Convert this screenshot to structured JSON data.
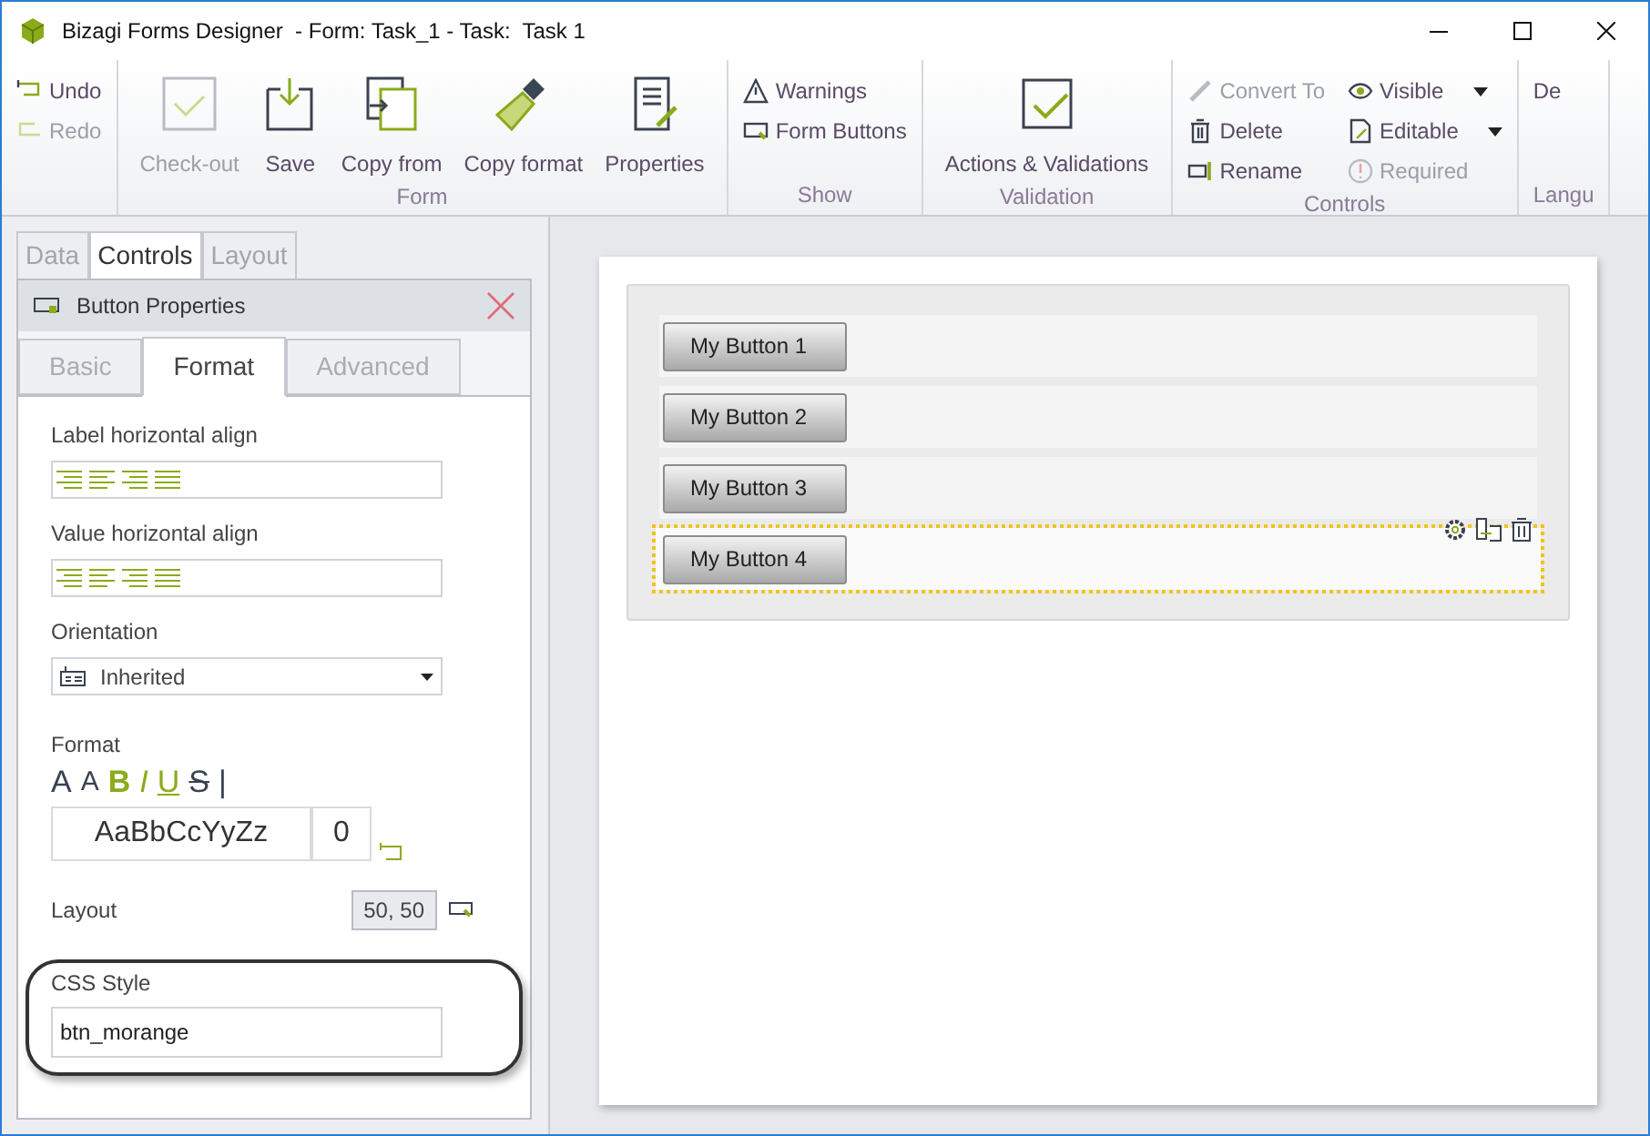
{
  "window": {
    "title": "Bizagi Forms Designer  - Form: Task_1 - Task:  Task 1"
  },
  "ribbon": [
    {
      "columns": [
        {
          "kind": "small",
          "items": [
            {
              "label": "Undo",
              "disabled": false
            },
            {
              "label": "Redo",
              "disabled": true
            }
          ]
        }
      ]
    },
    {
      "label": "Form",
      "columns": [
        {
          "kind": "large",
          "items": [
            {
              "label": "Check-out",
              "disabled": true
            },
            {
              "label": "Save",
              "disabled": false
            },
            {
              "label": "Copy from",
              "disabled": false
            },
            {
              "label": "Copy format",
              "disabled": false
            },
            {
              "label": "Properties",
              "disabled": false
            }
          ]
        }
      ]
    },
    {
      "label": "Show",
      "columns": [
        {
          "kind": "small",
          "items": [
            {
              "label": "Warnings",
              "disabled": false
            },
            {
              "label": "Form Buttons",
              "disabled": false
            }
          ]
        }
      ]
    },
    {
      "label": "Validation",
      "columns": [
        {
          "kind": "large",
          "items": [
            {
              "label": "Actions & Validations",
              "disabled": false
            }
          ]
        }
      ]
    },
    {
      "label": "Controls",
      "columns": [
        {
          "kind": "small",
          "items": [
            {
              "label": "Convert To",
              "disabled": true
            },
            {
              "label": "Delete",
              "disabled": false
            },
            {
              "label": "Rename",
              "disabled": false
            }
          ]
        },
        {
          "kind": "small",
          "items": [
            {
              "label": "Visible",
              "disabled": false,
              "has_menu": true
            },
            {
              "label": "Editable",
              "disabled": false,
              "has_menu": true
            },
            {
              "label": "Required",
              "disabled": true
            }
          ]
        }
      ]
    },
    {
      "label": "Langu",
      "columns": [
        {
          "kind": "small",
          "items": [
            {
              "label": "De",
              "disabled": false
            }
          ]
        }
      ]
    }
  ],
  "panel_tabs": [
    {
      "label": "Data",
      "selected": false
    },
    {
      "label": "Controls",
      "selected": true
    },
    {
      "label": "Layout",
      "selected": false
    }
  ],
  "properties": {
    "title": "Button Properties",
    "tabs": [
      {
        "label": "Basic",
        "selected": false
      },
      {
        "label": "Format",
        "selected": true
      },
      {
        "label": "Advanced",
        "selected": false
      }
    ],
    "label_align": {
      "label": "Label horizontal align"
    },
    "value_align": {
      "label": "Value horizontal align"
    },
    "orientation": {
      "label": "Orientation",
      "value": "Inherited"
    },
    "format": {
      "label": "Format",
      "tools": [
        {
          "kind": "grow",
          "text": "A"
        },
        {
          "kind": "shrink",
          "text": "A"
        },
        {
          "kind": "bold",
          "text": "B"
        },
        {
          "kind": "italic",
          "text": "I"
        },
        {
          "kind": "underline",
          "text": "U"
        },
        {
          "kind": "strike",
          "text": "S"
        },
        {
          "kind": "separator",
          "text": "|"
        }
      ],
      "preview": "AaBbCcYyZz",
      "size": "0"
    },
    "layout": {
      "label": "Layout",
      "value": "50, 50"
    },
    "css_style": {
      "label": "CSS Style",
      "value": "btn_morange",
      "highlighted": true
    }
  },
  "canvas": {
    "rows": [
      {
        "button": "My Button 1",
        "selected": false
      },
      {
        "button": "My Button 2",
        "selected": false
      },
      {
        "button": "My Button 3",
        "selected": false
      },
      {
        "button": "My Button 4",
        "selected": true
      }
    ]
  }
}
